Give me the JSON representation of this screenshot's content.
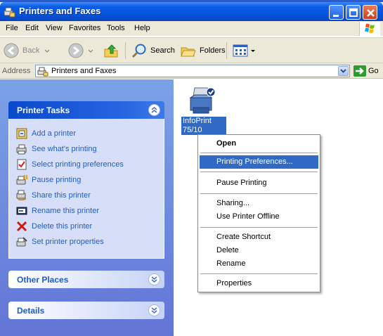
{
  "window": {
    "title": "Printers and Faxes"
  },
  "menubar": {
    "items": [
      "File",
      "Edit",
      "View",
      "Favorites",
      "Tools",
      "Help"
    ]
  },
  "toolbar": {
    "back_label": "Back",
    "search_label": "Search",
    "folders_label": "Folders"
  },
  "address": {
    "label": "Address",
    "value": "Printers and Faxes",
    "go_label": "Go"
  },
  "taskpane": {
    "printer_tasks": {
      "title": "Printer Tasks",
      "items": [
        {
          "label": "Add a printer",
          "icon": "add-printer-icon"
        },
        {
          "label": "See what's printing",
          "icon": "print-queue-icon"
        },
        {
          "label": "Select printing preferences",
          "icon": "preferences-icon"
        },
        {
          "label": "Pause printing",
          "icon": "pause-printing-icon"
        },
        {
          "label": "Share this printer",
          "icon": "share-printer-icon"
        },
        {
          "label": "Rename this printer",
          "icon": "rename-icon"
        },
        {
          "label": "Delete this printer",
          "icon": "delete-icon"
        },
        {
          "label": "Set printer properties",
          "icon": "printer-properties-icon"
        }
      ]
    },
    "other_places": {
      "title": "Other Places"
    },
    "details": {
      "title": "Details"
    }
  },
  "content": {
    "printer": {
      "name_line1": "InfoPrint",
      "name_line2": "75/10"
    }
  },
  "context_menu": {
    "items": [
      {
        "label": "Open",
        "bold": true
      },
      {
        "label": "Printing Preferences...",
        "selected": true
      },
      {
        "label": "Pause Printing"
      },
      {
        "label": "Sharing..."
      },
      {
        "label": "Use Printer Offline"
      },
      {
        "label": "Create Shortcut"
      },
      {
        "label": "Delete"
      },
      {
        "label": "Rename"
      },
      {
        "label": "Properties"
      }
    ]
  },
  "colors": {
    "titlebar": "#0b5ce6",
    "taskpane_bg": "#7ba2e7",
    "link_blue": "#215dc6",
    "selection": "#316ac5"
  }
}
